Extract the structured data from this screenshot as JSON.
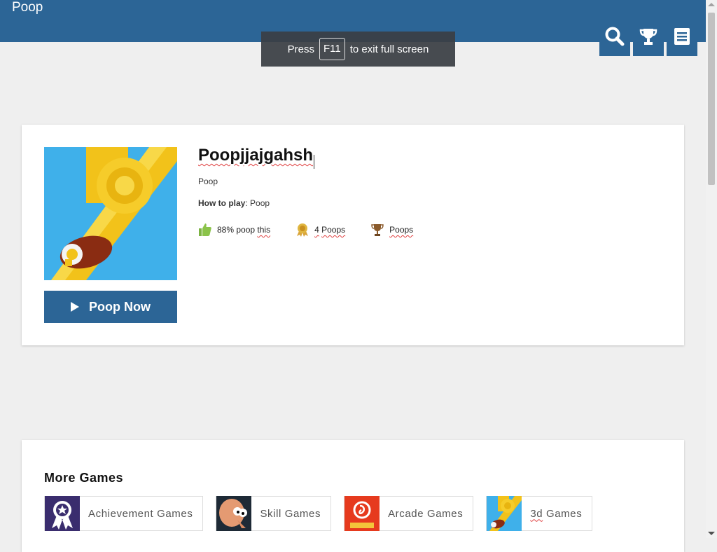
{
  "header": {
    "site_title": "Poop",
    "buttons": [
      {
        "icon": "search-icon"
      },
      {
        "icon": "trophy-icon"
      },
      {
        "icon": "menu-icon"
      }
    ],
    "color": "#2c6596"
  },
  "fullscreen_toast": {
    "prefix": "Press",
    "key": "F11",
    "suffix": "to exit full screen"
  },
  "game": {
    "title": "Poopjjajgahsh",
    "description": "Poop",
    "how_to_play_label": "How to play",
    "how_to_play_text": ": Poop",
    "play_button_label": "Poop Now",
    "stats": {
      "rating_prefix": "88% poop",
      "rating_link": "this",
      "achievements_count": "4",
      "achievements_label": "Poops",
      "leaderboard_label": "Poops"
    }
  },
  "more_games": {
    "heading": "More Games",
    "categories": [
      {
        "label": "Achievement Games",
        "icon": "achievement-ribbon-icon"
      },
      {
        "label": "Skill Games",
        "icon": "skill-face-icon"
      },
      {
        "label": "Arcade Games",
        "icon": "bitlife-icon"
      },
      {
        "label_first": "3d",
        "label_rest": " Games",
        "icon": "3d-games-icon"
      }
    ]
  }
}
